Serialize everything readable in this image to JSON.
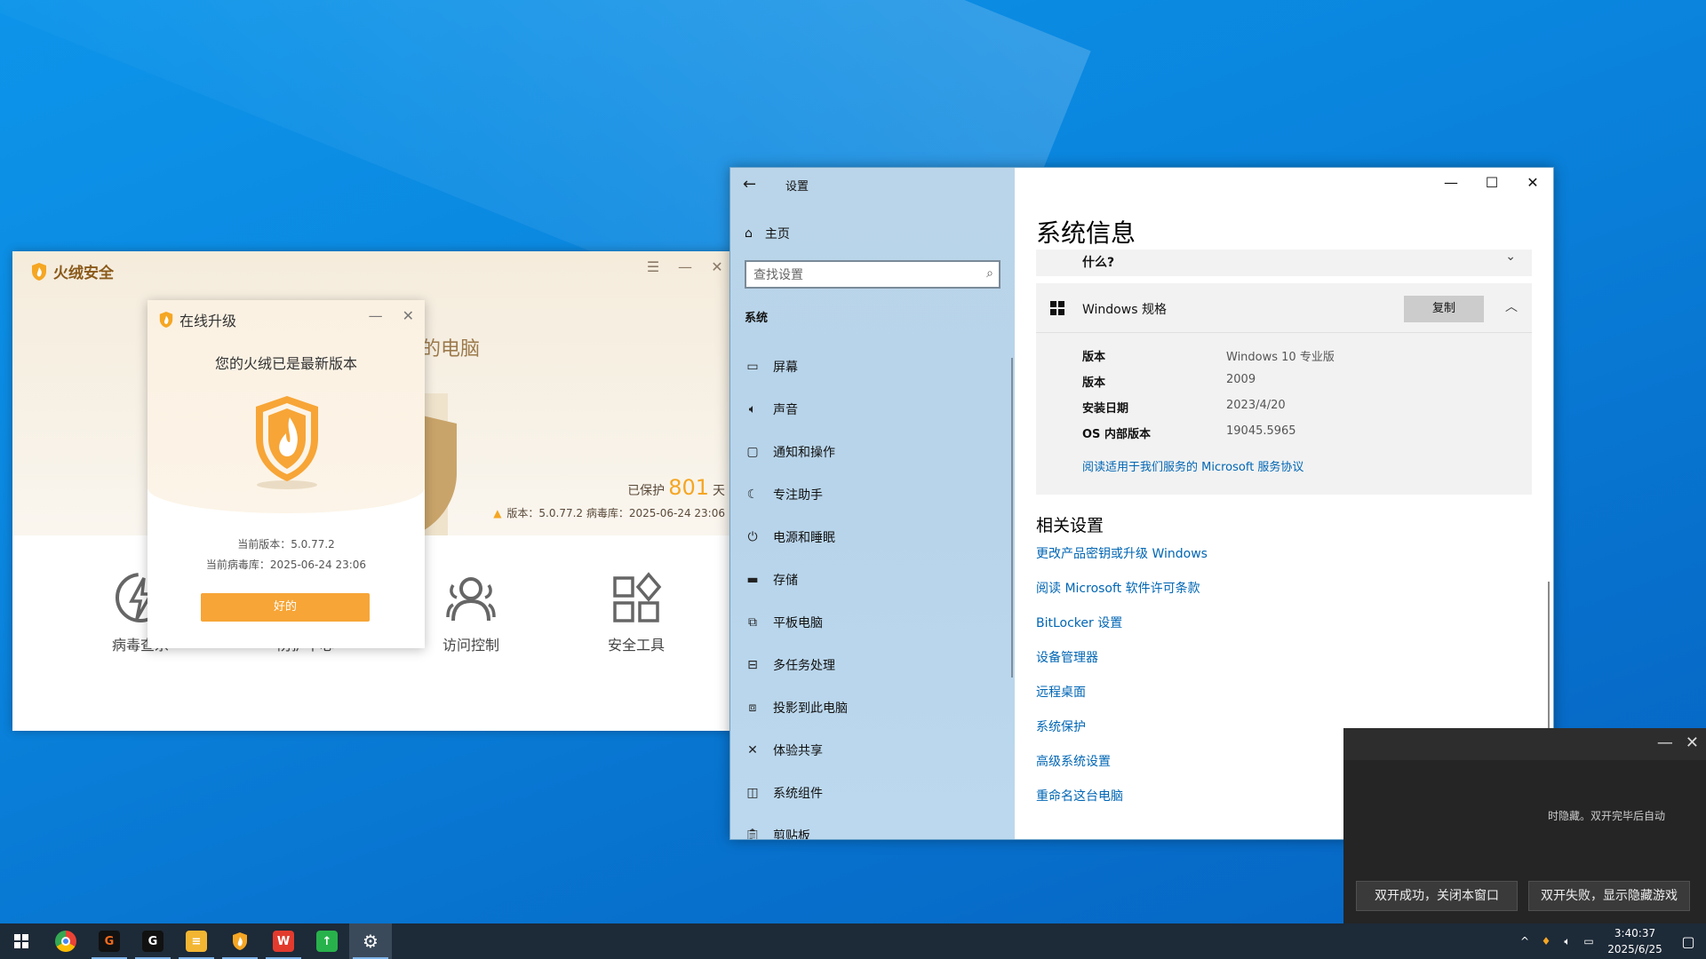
{
  "huorong": {
    "app_name": "火绒安全",
    "slogan": "的电脑",
    "protected_prefix": "已保护",
    "protected_days": "801",
    "protected_suffix": "天",
    "version_line": "版本：5.0.77.2  病毒库：2025-06-24 23:06",
    "features": [
      {
        "label": "病毒查杀",
        "icon": "lightning-icon"
      },
      {
        "label": "防护中心",
        "icon": "shield-icon"
      },
      {
        "label": "访问控制",
        "icon": "users-icon"
      },
      {
        "label": "安全工具",
        "icon": "apps-grid-icon"
      }
    ],
    "accent": "#f5a623"
  },
  "upgrade_dialog": {
    "title": "在线升级",
    "message": "您的火绒已是最新版本",
    "current_version": "当前版本：5.0.77.2",
    "current_db": "当前病毒库：2025-06-24 23:06",
    "ok_label": "好的",
    "button_color": "#f7a536"
  },
  "settings": {
    "app_title": "设置",
    "home_label": "主页",
    "search_placeholder": "查找设置",
    "section_label": "系统",
    "nav_items": [
      {
        "label": "屏幕",
        "icon": "monitor-icon"
      },
      {
        "label": "声音",
        "icon": "speaker-icon"
      },
      {
        "label": "通知和操作",
        "icon": "message-icon"
      },
      {
        "label": "专注助手",
        "icon": "moon-icon"
      },
      {
        "label": "电源和睡眠",
        "icon": "power-icon"
      },
      {
        "label": "存储",
        "icon": "storage-icon"
      },
      {
        "label": "平板电脑",
        "icon": "tablet-icon"
      },
      {
        "label": "多任务处理",
        "icon": "multitask-icon"
      },
      {
        "label": "投影到此电脑",
        "icon": "project-icon"
      },
      {
        "label": "体验共享",
        "icon": "share-icon"
      },
      {
        "label": "系统组件",
        "icon": "components-icon"
      },
      {
        "label": "剪贴板",
        "icon": "clipboard-icon"
      }
    ],
    "page_title": "系统信息",
    "collapsed_card_title": "什么?",
    "spec_title": "Windows 规格",
    "copy_label": "复制",
    "specs": [
      {
        "key": "版本",
        "value": "Windows 10 专业版"
      },
      {
        "key": "版本",
        "value": "2009"
      },
      {
        "key": "安装日期",
        "value": "2023/4/20"
      },
      {
        "key": "OS 内部版本",
        "value": "19045.5965"
      }
    ],
    "spec_link": "阅读适用于我们服务的 Microsoft 服务协议",
    "related_title": "相关设置",
    "related_links": [
      "更改产品密钥或升级 Windows",
      "阅读 Microsoft 软件许可条款",
      "BitLocker 设置",
      "设备管理器",
      "远程桌面",
      "系统保护",
      "高级系统设置",
      "重命名这台电脑"
    ],
    "link_color": "#0066b4"
  },
  "dark_dialog": {
    "message": "时隐藏。双开完毕后自动",
    "btn_success": "双开成功，关闭本窗口",
    "btn_fail": "双开失败，显示隐藏游戏"
  },
  "taskbar": {
    "apps": [
      {
        "name": "chrome",
        "icon": "chrome-icon",
        "color": "#ea4335",
        "glyph": "◉"
      },
      {
        "name": "app-g1",
        "icon": "g-app-icon",
        "color": "#111111",
        "glyph": "G"
      },
      {
        "name": "app-g2",
        "icon": "g-app-icon",
        "color": "#111111",
        "glyph": "G"
      },
      {
        "name": "notes",
        "icon": "notes-icon",
        "color": "#f3b632",
        "glyph": "≡"
      },
      {
        "name": "huorong",
        "icon": "huorong-icon",
        "color": "#f5a623",
        "glyph": "♦"
      },
      {
        "name": "wps",
        "icon": "wps-icon",
        "color": "#e23b2e",
        "glyph": "W"
      },
      {
        "name": "updater",
        "icon": "upload-icon",
        "color": "#28b24b",
        "glyph": "↑"
      },
      {
        "name": "settings",
        "icon": "gear-icon",
        "color": "#3b4a5a",
        "glyph": "⚙"
      }
    ],
    "time": "3:40:37",
    "date": "2025/6/25"
  }
}
